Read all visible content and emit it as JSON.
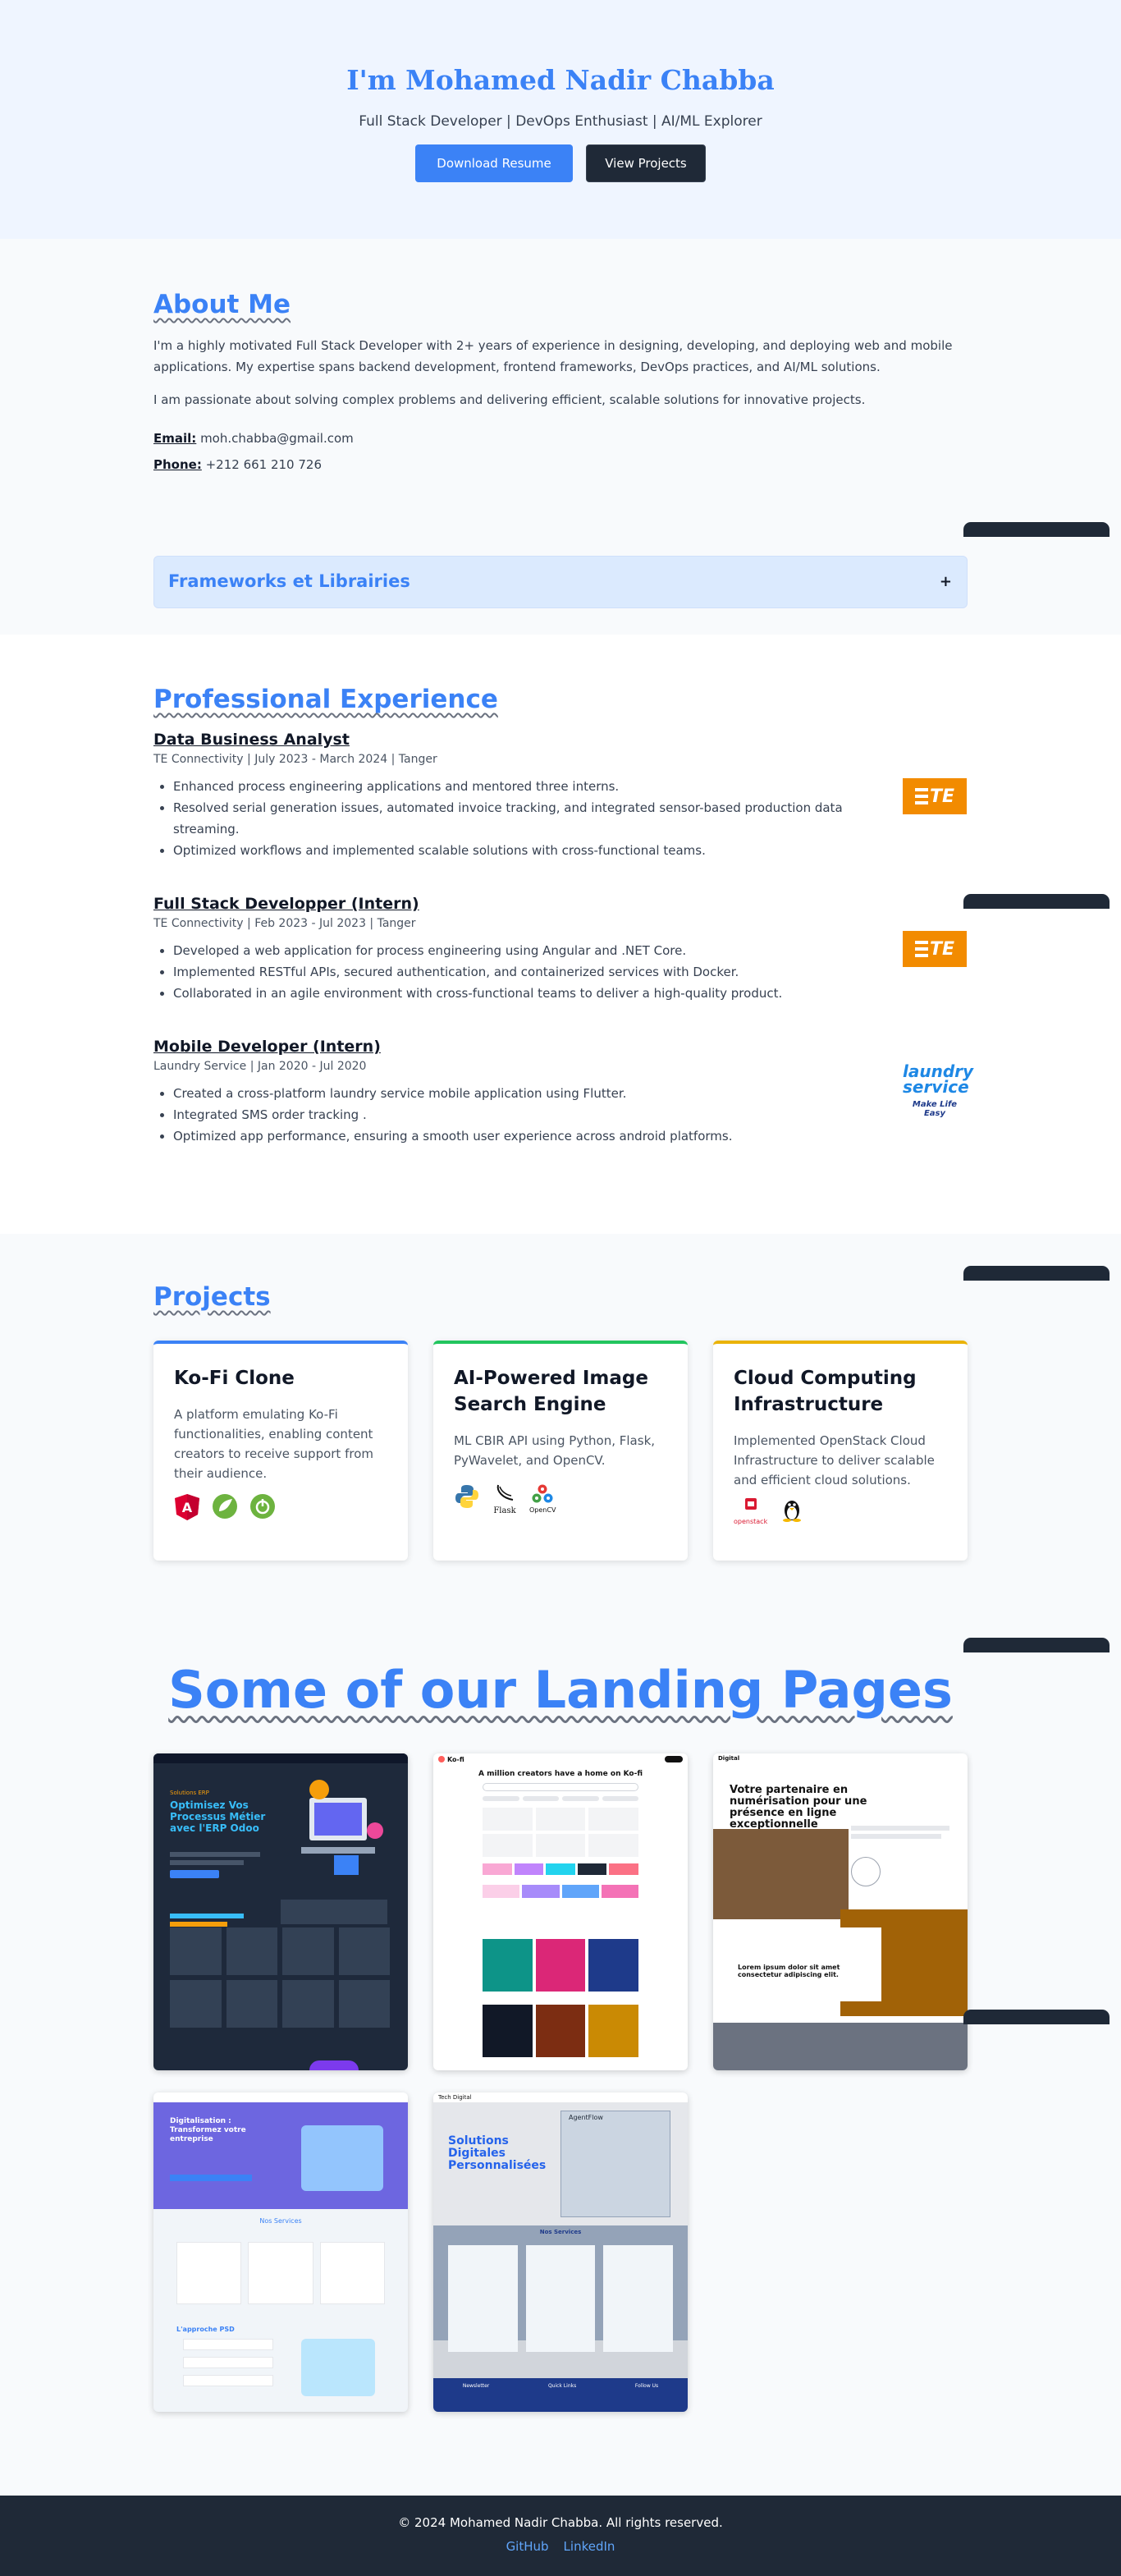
{
  "hero": {
    "title": "I'm Mohamed Nadir Chabba",
    "subtitle": "Full Stack Developer | DevOps Enthusiast | AI/ML Explorer",
    "download_label": "Download Resume",
    "view_label": "View Projects"
  },
  "about": {
    "title": "About Me",
    "p1": "I'm a highly motivated Full Stack Developer with 2+ years of experience in designing, developing, and deploying web and mobile applications. My expertise spans backend development, frontend frameworks, DevOps practices, and AI/ML solutions.",
    "p2": "I am passionate about solving complex problems and delivering efficient, scalable solutions for innovative projects.",
    "email_label": "Email:",
    "email": "moh.chabba@gmail.com",
    "phone_label": "Phone:",
    "phone": "+212 661 210 726"
  },
  "accordion": {
    "label": "Frameworks et Librairies",
    "toggle": "+"
  },
  "experience": {
    "title": "Professional Experience",
    "jobs": [
      {
        "title": "Data Business Analyst",
        "meta": "TE Connectivity | July 2023 - March 2024 | Tanger",
        "bullets": [
          "Enhanced process engineering applications and mentored three interns.",
          "Resolved serial generation issues, automated invoice tracking, and integrated sensor-based production data streaming.",
          "Optimized workflows and implemented scalable solutions with cross-functional teams."
        ],
        "logo": "TE"
      },
      {
        "title": "Full Stack Developper (Intern)",
        "meta": "TE Connectivity | Feb 2023 - Jul 2023 | Tanger",
        "bullets": [
          "Developed a web application for process engineering using Angular and .NET Core.",
          "Implemented RESTful APIs, secured authentication, and containerized services with Docker.",
          "Collaborated in an agile environment with cross-functional teams to deliver a high-quality product."
        ],
        "logo": "TE"
      },
      {
        "title": "Mobile Developer (Intern)",
        "meta": "Laundry Service | Jan 2020 - Jul 2020",
        "bullets": [
          "Created a cross-platform laundry service mobile application using Flutter.",
          "Integrated SMS order tracking .",
          "Optimized app performance, ensuring a smooth user experience across android platforms."
        ],
        "logo_line1": "laundry",
        "logo_line2": "service",
        "logo_tagline": "Make Life Easy"
      }
    ]
  },
  "projects": {
    "title": "Projects",
    "cards": [
      {
        "title": "Ko-Fi Clone",
        "desc": "A platform emulating Ko-Fi functionalities, enabling content creators to receive support from their audience.",
        "accent": "#3b82f6",
        "icons": [
          "angular-icon",
          "spring-icon",
          "spring-boot-icon"
        ]
      },
      {
        "title": "AI-Powered Image Search Engine",
        "desc": "ML CBIR API using Python, Flask, PyWavelet, and OpenCV.",
        "accent": "#22c55e",
        "icons": [
          "python-icon",
          "flask-icon",
          "opencv-icon"
        ],
        "icon_captions": [
          "Flask",
          "OpenCV"
        ]
      },
      {
        "title": "Cloud Computing Infrastructure",
        "desc": "Implemented OpenStack Cloud Infrastructure to deliver scalable and efficient cloud solutions.",
        "accent": "#eab308",
        "icons": [
          "openstack-icon",
          "linux-icon"
        ],
        "icon_captions": [
          "openstack"
        ]
      }
    ]
  },
  "landing": {
    "title": "Some of our Landing Pages",
    "thumb1": {
      "headline": "Optimisez Vos Processus Métier avec l'ERP Odoo",
      "eyebrow": "Solutions ERP"
    },
    "thumb2": {
      "brand": "Ko-fi",
      "headline": "A million creators have a home on Ko-fi"
    },
    "thumb3": {
      "brand": "Digital",
      "headline": "Votre partenaire en numérisation pour une présence en ligne exceptionnelle",
      "sub": "Lorem ipsum dolor sit amet consectetur adipiscing elit."
    },
    "thumb4": {
      "headline": "Digitalisation : Transformez votre entreprise",
      "services": "Nos Services",
      "approach": "L'approche PSD"
    },
    "thumb5": {
      "brand": "Tech Digital",
      "headline": "Solutions Digitales Personnalisées",
      "badge": "AgentFlow",
      "services": "Nos Services",
      "footer_col1": "Newsletter",
      "footer_col2": "Quick Links",
      "footer_col3": "Follow Us"
    }
  },
  "footer": {
    "copyright": "© 2024 Mohamed Nadir Chabba. All rights reserved.",
    "github": "GitHub",
    "linkedin": "LinkedIn"
  },
  "colors": {
    "accent": "#3b82f6",
    "dark": "#1f2937",
    "te_orange": "#f28b00"
  }
}
